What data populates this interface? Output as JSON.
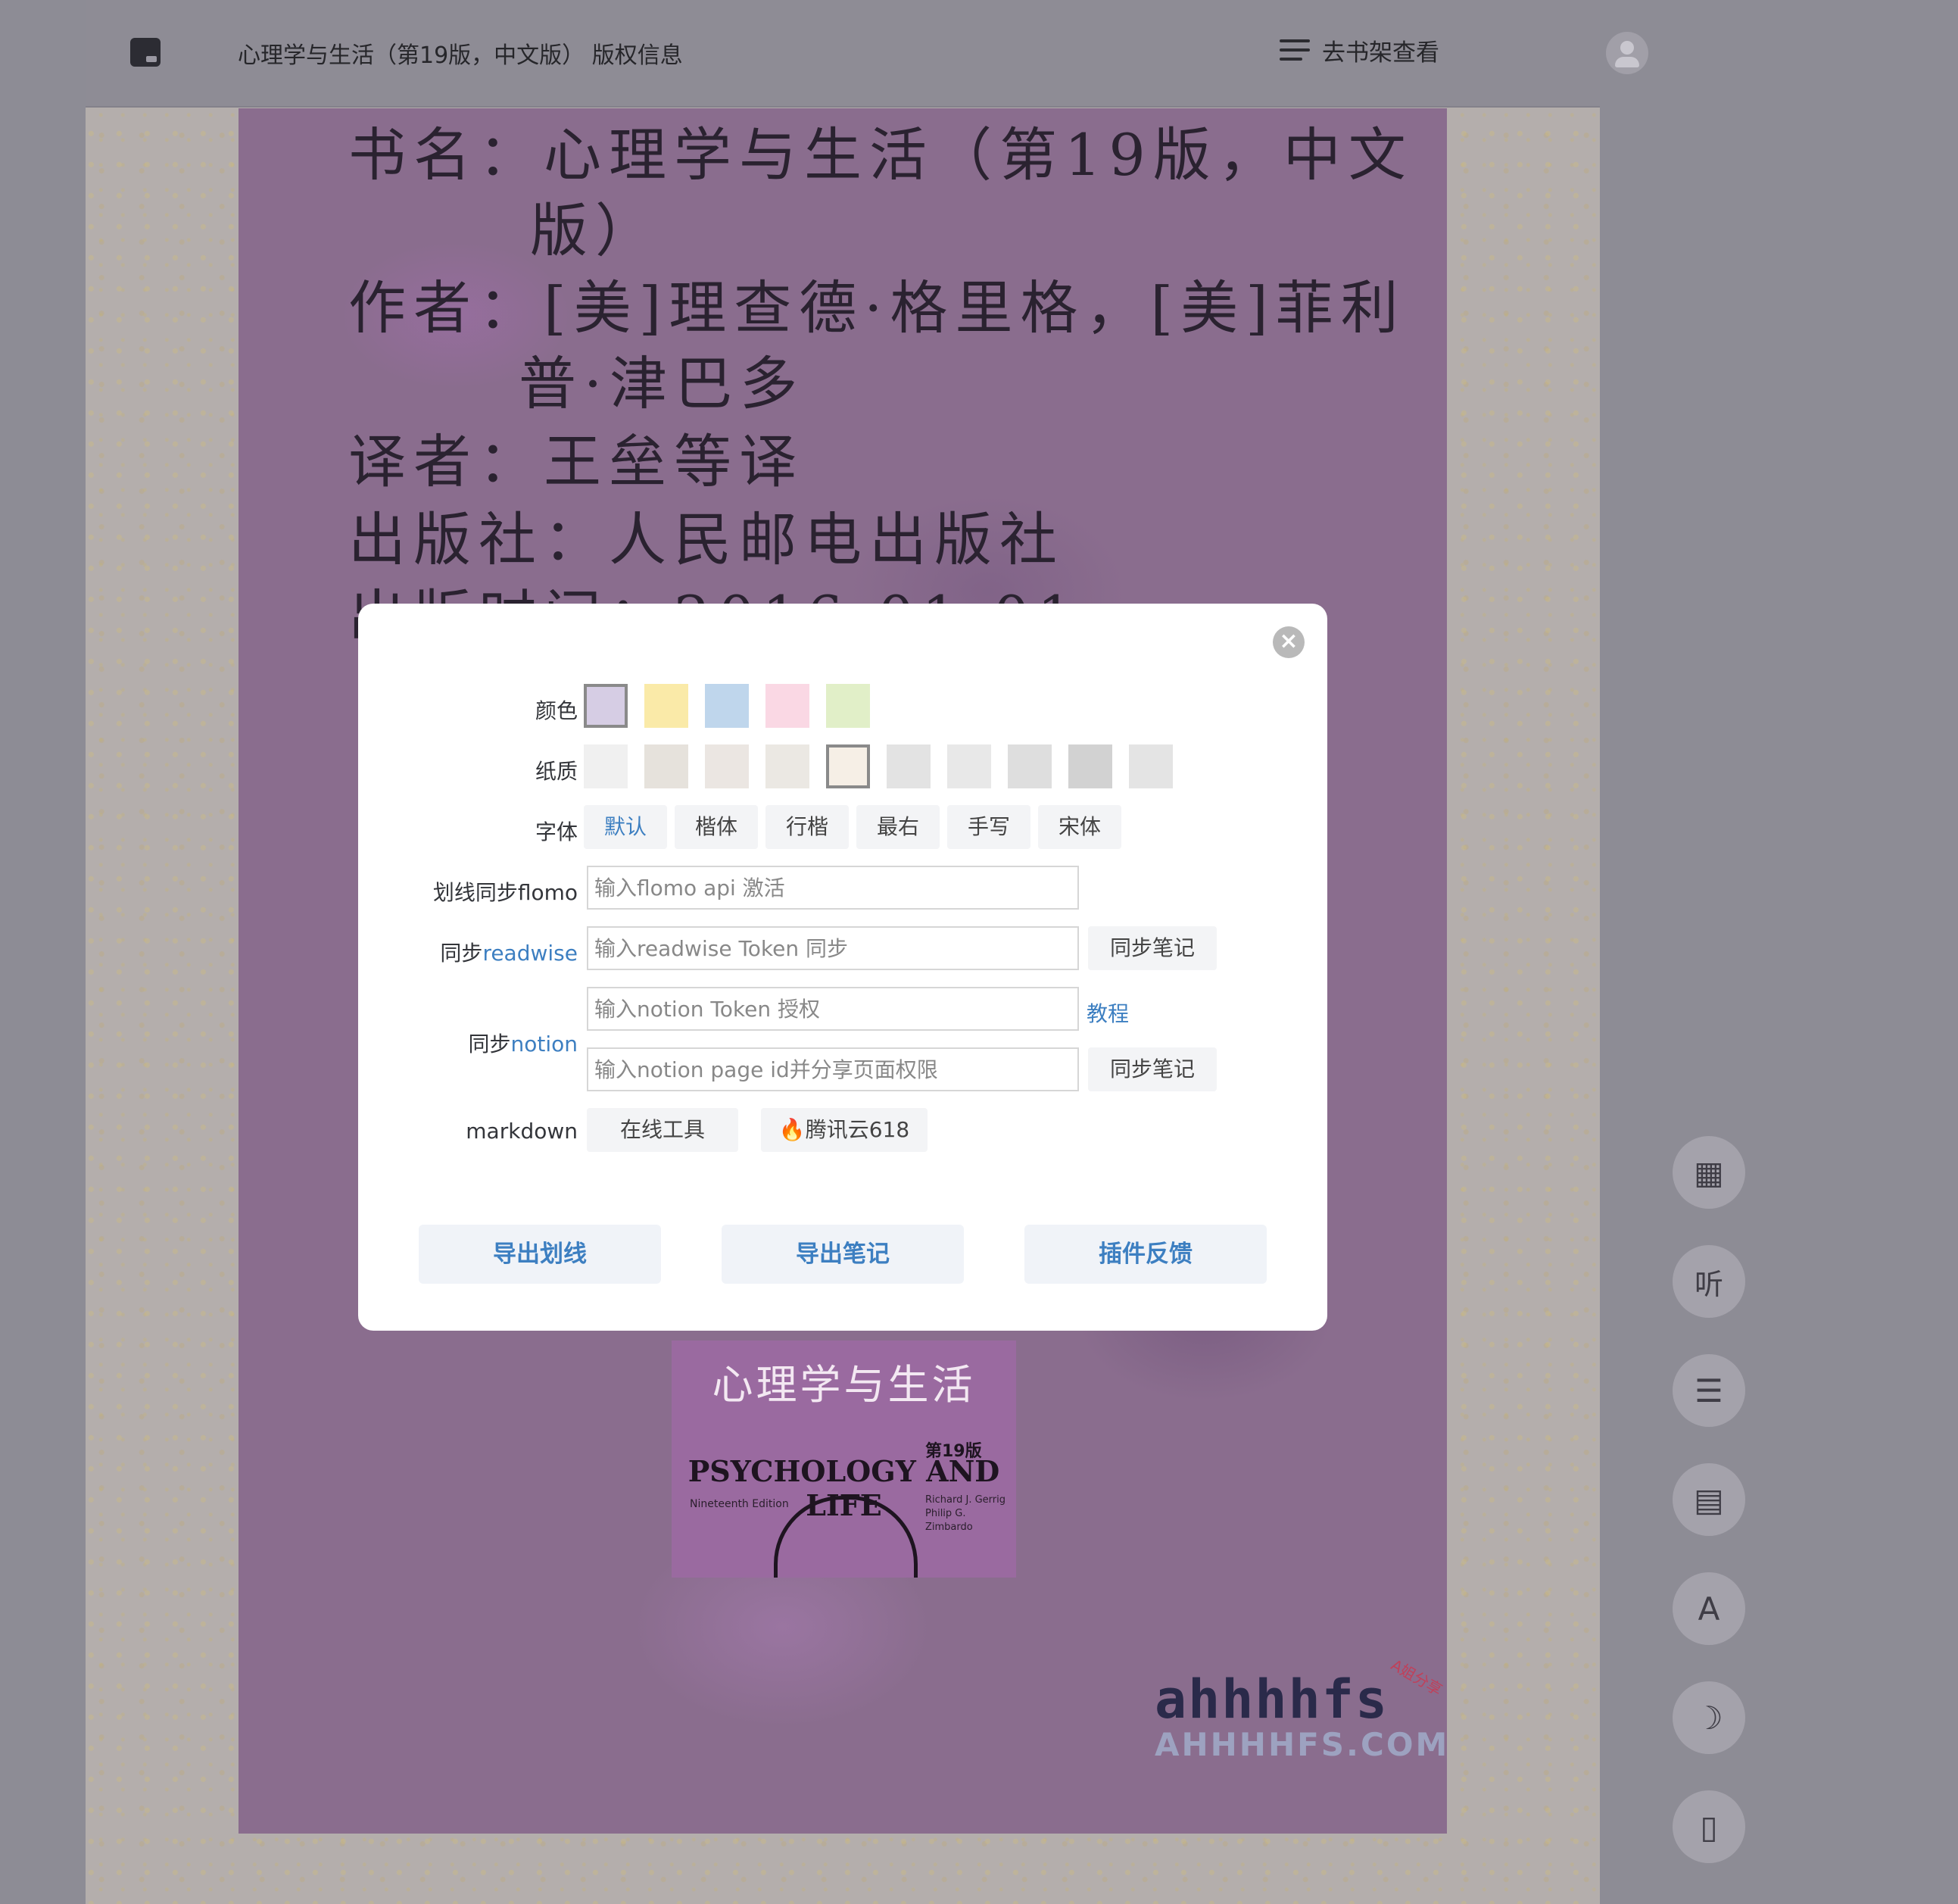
{
  "header": {
    "book_title": "心理学与生活（第19版，中文版） 版权信息",
    "shelf_label": "去书架查看"
  },
  "page": {
    "lines": [
      "书名：心理学与生活（第19版，中文",
      "版）",
      "作者：[美]理查德·格里格，[美]菲利",
      "普·津巴多",
      "译者：王垒等译",
      "出版社：人民邮电出版社",
      "出版时间：2016-01-01"
    ],
    "cover": {
      "title_cn": "心理学与生活",
      "edition_badge": "第19版",
      "title_en": "PSYCHOLOGY AND LIFE",
      "edition_en": "Nineteenth Edition",
      "authors": [
        "Richard J. Gerrig",
        "Philip G. Zimbardo"
      ]
    },
    "watermark": {
      "logo": "ahhhhfs",
      "tag": "A姐分享",
      "url": "AHHHHFS.COM"
    }
  },
  "side_tools": [
    {
      "name": "grid-icon",
      "glyph": "▦"
    },
    {
      "name": "listen-icon",
      "glyph": "听"
    },
    {
      "name": "menu-icon",
      "glyph": "☰"
    },
    {
      "name": "comment-icon",
      "glyph": "▤"
    },
    {
      "name": "font-icon",
      "glyph": "A"
    },
    {
      "name": "moon-icon",
      "glyph": "☽"
    },
    {
      "name": "tablet-icon",
      "glyph": "▯"
    }
  ],
  "modal": {
    "close_glyph": "×",
    "color": {
      "label": "颜色",
      "options": [
        "#d6cde4",
        "#faeaa8",
        "#bfd6ec",
        "#fad8e4",
        "#e1efc8"
      ],
      "selected": 0
    },
    "paper": {
      "label": "纸质",
      "count": 10,
      "selected": 4
    },
    "font": {
      "label": "字体",
      "options": [
        "默认",
        "楷体",
        "行楷",
        "最右",
        "手写",
        "宋体"
      ],
      "selected": 0
    },
    "flomo": {
      "label": "划线同步flomo",
      "placeholder": "输入flomo api 激活"
    },
    "readwise": {
      "label_prefix": "同步",
      "label_link": "readwise",
      "placeholder": "输入readwise Token 同步",
      "sync_label": "同步笔记"
    },
    "notion": {
      "label_prefix": "同步",
      "label_link": "notion",
      "token_placeholder": "输入notion Token 授权",
      "tutorial_label": "教程",
      "page_placeholder": "输入notion page id并分享页面权限",
      "sync_label": "同步笔记"
    },
    "markdown": {
      "label": "markdown",
      "online_tool": "在线工具",
      "promo": "🔥腾讯云618"
    },
    "actions": {
      "export_highlights": "导出划线",
      "export_notes": "导出笔记",
      "feedback": "插件反馈"
    }
  }
}
